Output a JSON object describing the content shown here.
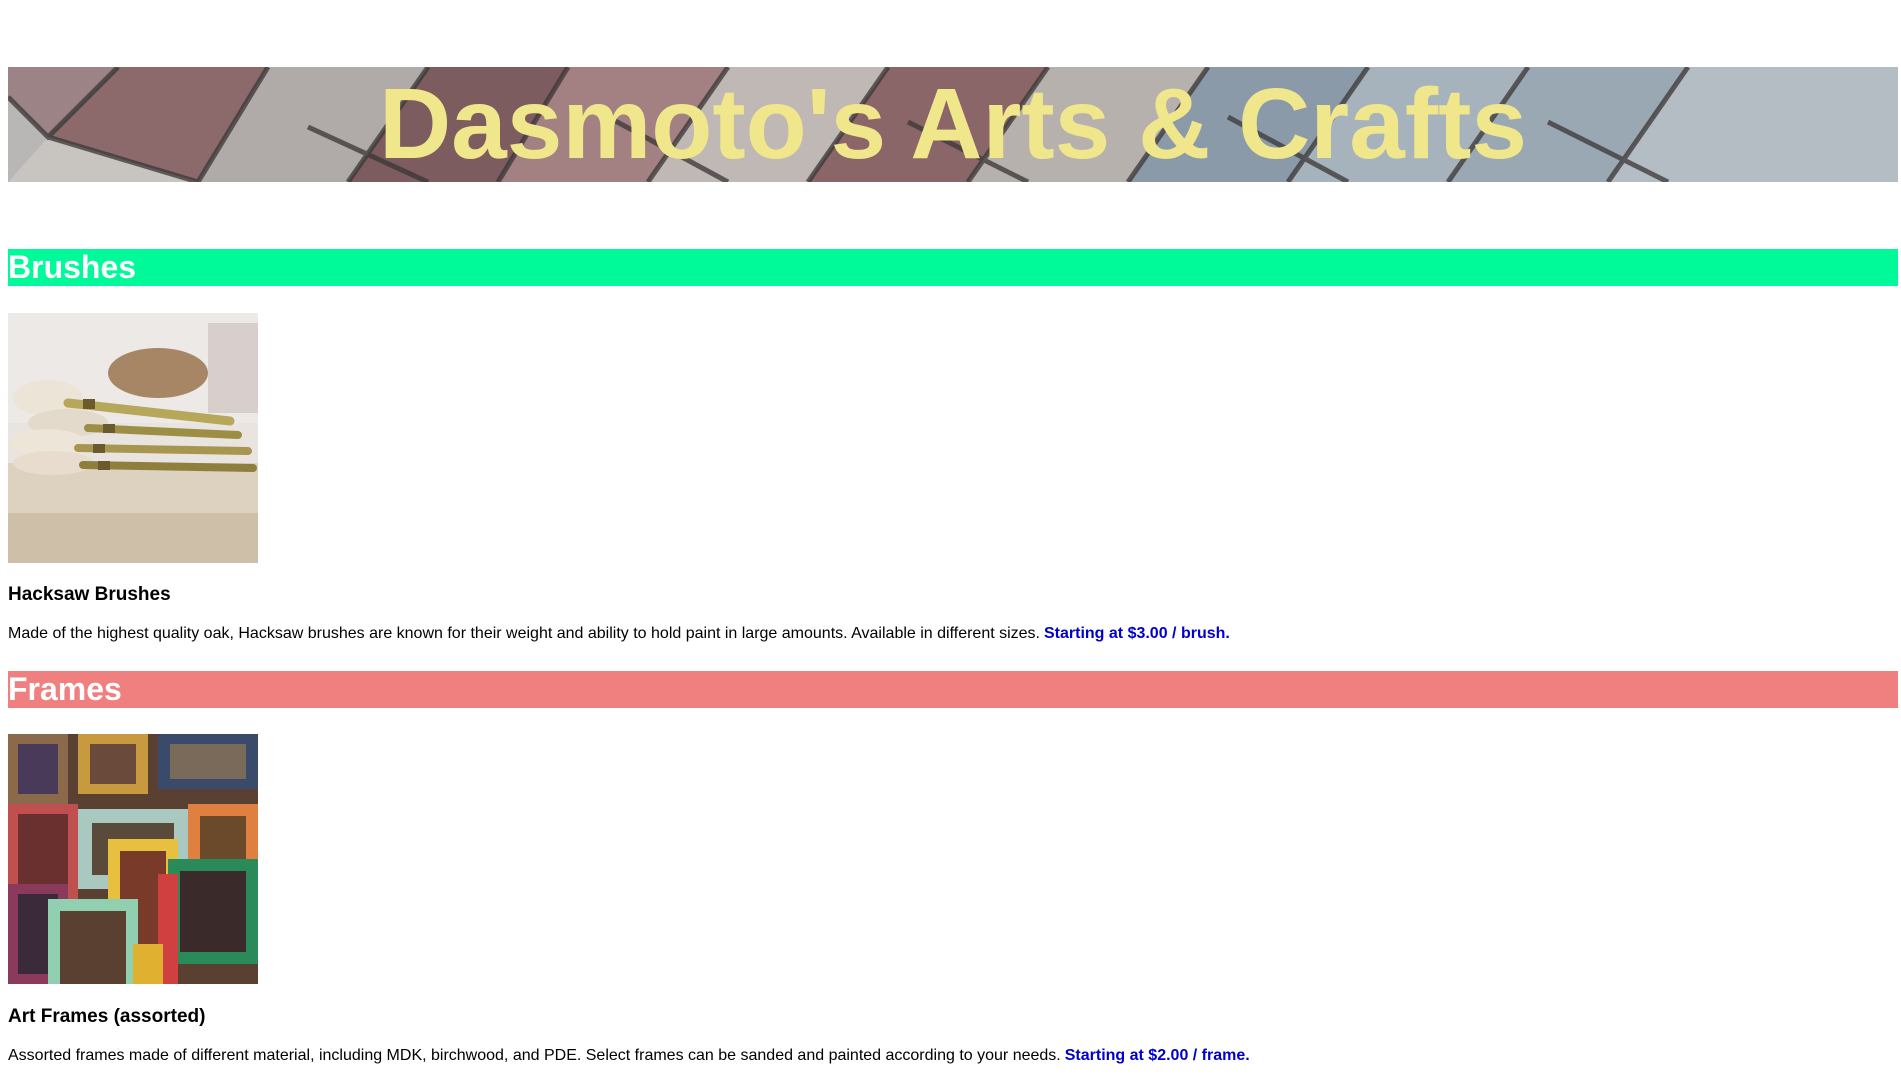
{
  "header": {
    "title": "Dasmoto's Arts & Crafts"
  },
  "sections": [
    {
      "heading": "Brushes",
      "heading_color": "#00fa9a",
      "product_name": "Hacksaw Brushes",
      "description": "Made of the highest quality oak, Hacksaw brushes are known for their weight and ability to hold paint in large amounts. Available in different sizes.",
      "price": "Starting at $3.00 / brush."
    },
    {
      "heading": "Frames",
      "heading_color": "#f08080",
      "product_name": "Art Frames (assorted)",
      "description": "Assorted frames made of different material, including MDK, birchwood, and PDE. Select frames can be sanded and painted according to your needs.",
      "price": "Starting at $2.00 / frame."
    }
  ],
  "colors": {
    "title_text": "#f0e68c",
    "price_text": "#0000cd",
    "heading_text": "#ffffff"
  }
}
